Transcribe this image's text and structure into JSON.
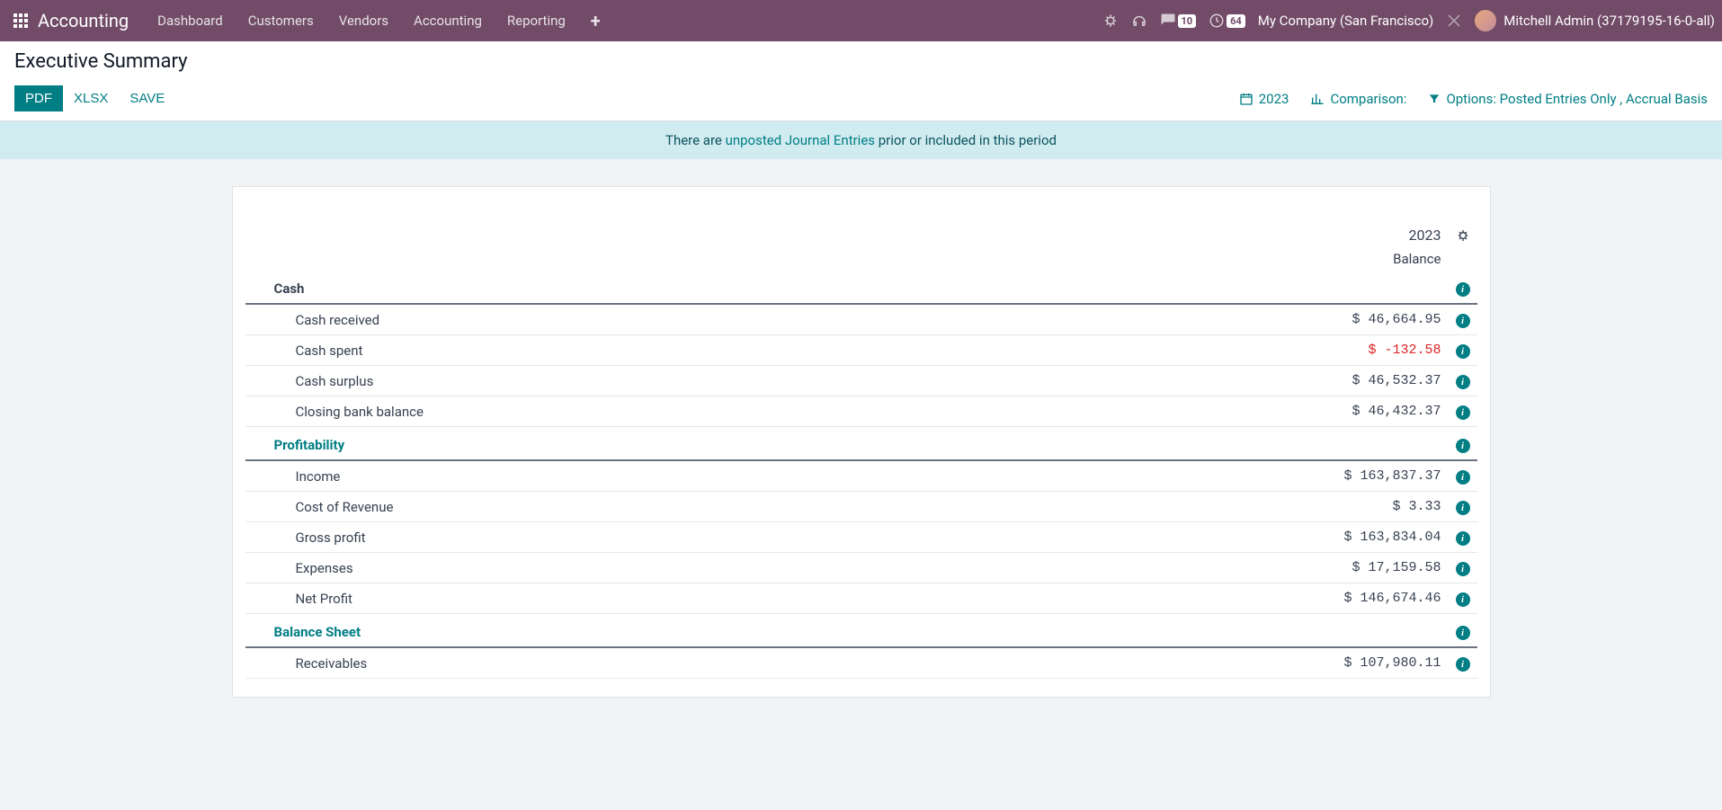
{
  "navbar": {
    "app_name": "Accounting",
    "menu": [
      "Dashboard",
      "Customers",
      "Vendors",
      "Accounting",
      "Reporting"
    ],
    "messages_badge": "10",
    "activities_badge": "64",
    "company": "My Company (San Francisco)",
    "user": "Mitchell Admin (37179195-16-0-all)"
  },
  "breadcrumb": "Executive Summary",
  "buttons": {
    "pdf": "PDF",
    "xlsx": "XLSX",
    "save": "SAVE"
  },
  "filters": {
    "date": "2023",
    "comparison": "Comparison:",
    "options_prefix": "Options: ",
    "options_value": "Posted Entries Only , Accrual Basis"
  },
  "alert": {
    "prefix": "There are ",
    "link": "unposted Journal Entries",
    "suffix": " prior or included in this period"
  },
  "report": {
    "header_year": "2023",
    "header_balance": "Balance",
    "sections": [
      {
        "title": "Cash",
        "linked": false,
        "lines": [
          {
            "label": "Cash received",
            "value": "$ 46,664.95",
            "neg": false
          },
          {
            "label": "Cash spent",
            "value": "$ -132.58",
            "neg": true
          },
          {
            "label": "Cash surplus",
            "value": "$ 46,532.37",
            "neg": false
          },
          {
            "label": "Closing bank balance",
            "value": "$ 46,432.37",
            "neg": false
          }
        ]
      },
      {
        "title": "Profitability",
        "linked": true,
        "lines": [
          {
            "label": "Income",
            "value": "$ 163,837.37",
            "neg": false
          },
          {
            "label": "Cost of Revenue",
            "value": "$ 3.33",
            "neg": false
          },
          {
            "label": "Gross profit",
            "value": "$ 163,834.04",
            "neg": false
          },
          {
            "label": "Expenses",
            "value": "$ 17,159.58",
            "neg": false
          },
          {
            "label": "Net Profit",
            "value": "$ 146,674.46",
            "neg": false
          }
        ]
      },
      {
        "title": "Balance Sheet",
        "linked": true,
        "lines": [
          {
            "label": "Receivables",
            "value": "$ 107,980.11",
            "neg": false
          }
        ]
      }
    ]
  }
}
